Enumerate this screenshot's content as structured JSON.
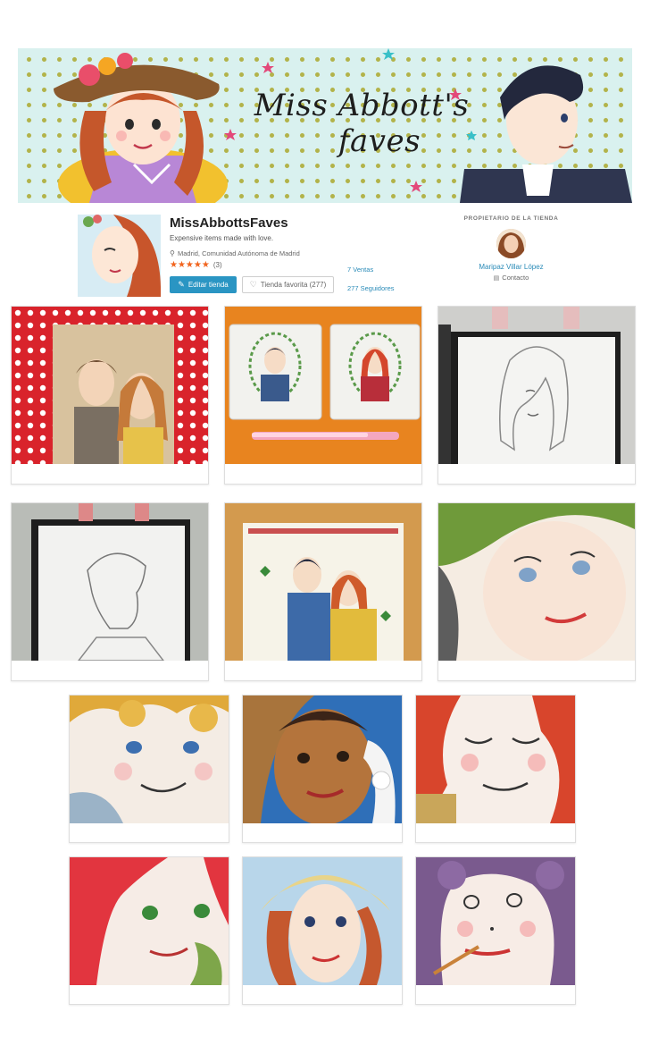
{
  "banner": {
    "title_line1": "Miss Abbott's",
    "title_line2": "faves"
  },
  "shop": {
    "name": "MissAbbottsFaves",
    "tagline": "Expensive items made with love.",
    "location": "Madrid, Comunidad Autónoma de Madrid",
    "stars": "★★★★★",
    "rating_value": 5,
    "review_count": "(3)",
    "edit_button_label": "Editar tienda",
    "favorite_button_label": "Tienda favorita (277)",
    "sales": "7 Ventas",
    "followers": "277 Seguidores",
    "icons": {
      "location": "map-pin-icon",
      "edit": "pencil-icon",
      "favorite": "heart-icon",
      "contact": "chat-icon"
    },
    "accent_color": "#2a95c3"
  },
  "owner": {
    "heading": "PROPIETARIO DE LA TIENDA",
    "name": "Maripaz Villar López",
    "contact_label": "Contacto"
  },
  "listings": [
    {
      "subject": "couple-sketch-on-polka-dot"
    },
    {
      "subject": "two-tile-portraits-with-pen"
    },
    {
      "subject": "pencil-girl-portrait-framed"
    },
    {
      "subject": "pencil-man-profile-framed"
    },
    {
      "subject": "couple-tile-with-clovers"
    },
    {
      "subject": "woman-green-hat-closeup"
    },
    {
      "subject": "blonde-boy-closeup"
    },
    {
      "subject": "bonnet-girl-closeup"
    },
    {
      "subject": "redhead-eyes-closed-closeup"
    },
    {
      "subject": "redhead-green-eyes-closeup"
    },
    {
      "subject": "yellow-bonnet-girl-closeup"
    },
    {
      "subject": "purple-hair-girl-closeup"
    }
  ]
}
